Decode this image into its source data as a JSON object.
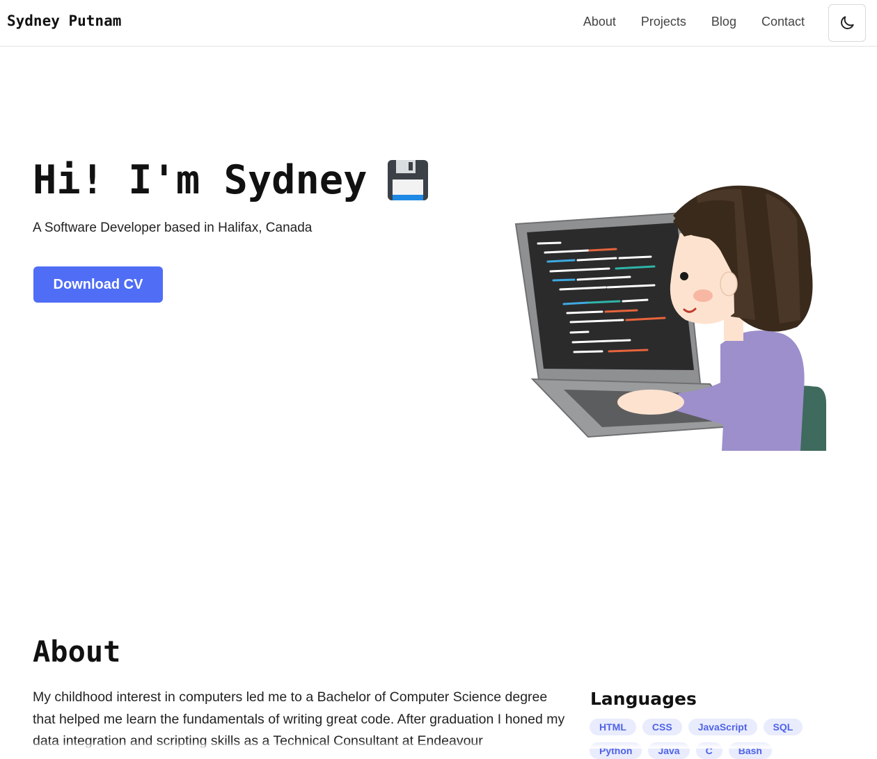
{
  "header": {
    "brand": "Sydney Putnam",
    "nav": [
      "About",
      "Projects",
      "Blog",
      "Contact"
    ],
    "theme_toggle_icon": "moon-icon"
  },
  "hero": {
    "title": "Hi! I'm Sydney",
    "title_icon": "floppy-disk-icon",
    "subtitle": "A Software Developer based in Halifax, Canada",
    "cta_label": "Download CV",
    "illustration": "girl-coding-on-laptop-illustration"
  },
  "about": {
    "title": "About",
    "text": "My childhood interest in computers led me to a Bachelor of Computer Science degree that helped me learn the fundamentals of writing great code. After graduation I honed my data integration and scripting skills as a Technical Consultant at Endeavour",
    "languages_title": "Languages",
    "languages": [
      "HTML",
      "CSS",
      "JavaScript",
      "SQL",
      "Python",
      "Java",
      "C",
      "Bash"
    ]
  },
  "colors": {
    "accent": "#4f6df5",
    "tag_bg": "#e9ecfd",
    "tag_text": "#4f63e6"
  }
}
